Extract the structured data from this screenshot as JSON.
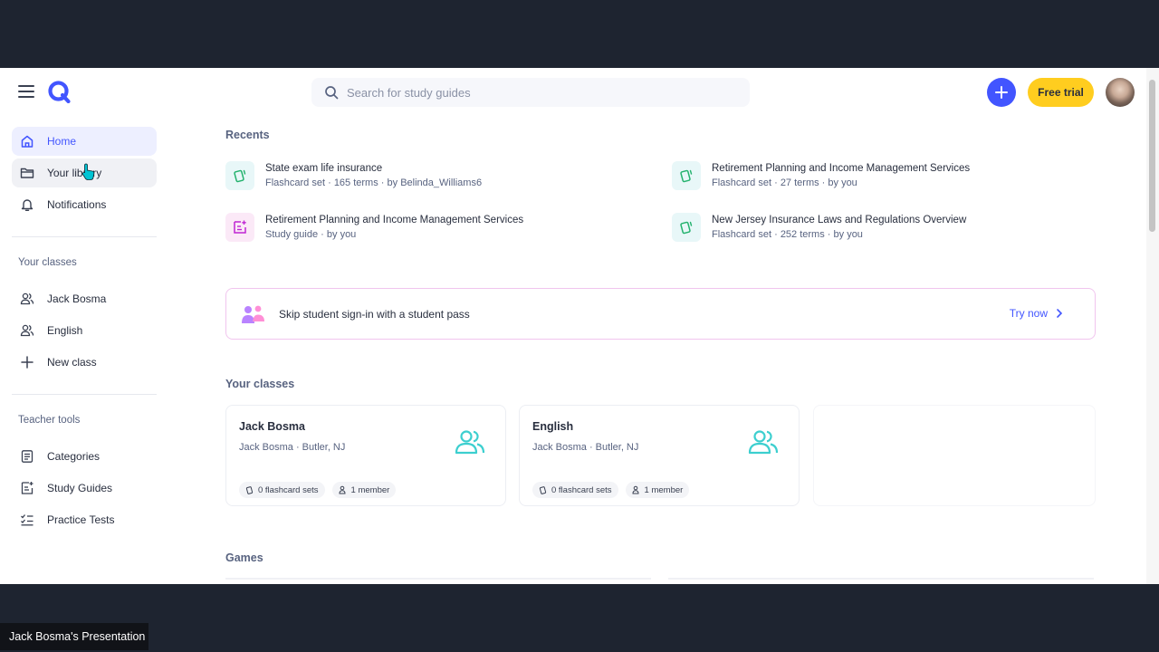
{
  "header": {
    "search_placeholder": "Search for study guides",
    "free_trial_label": "Free trial"
  },
  "sidebar": {
    "nav": [
      {
        "label": "Home",
        "icon": "home-icon"
      },
      {
        "label": "Your library",
        "icon": "folder-icon"
      },
      {
        "label": "Notifications",
        "icon": "bell-icon"
      }
    ],
    "classes_heading": "Your classes",
    "classes": [
      {
        "label": "Jack Bosma",
        "icon": "people-icon"
      },
      {
        "label": "English",
        "icon": "people-icon"
      },
      {
        "label": "New class",
        "icon": "plus-icon"
      }
    ],
    "tools_heading": "Teacher tools",
    "tools": [
      {
        "label": "Categories",
        "icon": "list-icon"
      },
      {
        "label": "Study Guides",
        "icon": "study-guide-icon"
      },
      {
        "label": "Practice Tests",
        "icon": "checklist-icon"
      }
    ]
  },
  "recents": {
    "heading": "Recents",
    "items": [
      {
        "title": "State exam life insurance",
        "type": "Flashcard set",
        "terms": "165 terms",
        "owner": "by Belinda_Williams6"
      },
      {
        "title": "Retirement Planning and Income Management Services",
        "type": "Flashcard set",
        "terms": "27 terms",
        "owner": "by you"
      },
      {
        "title": "Retirement Planning and Income Management Services",
        "type": "Study guide",
        "owner": "by you"
      },
      {
        "title": "New Jersey Insurance Laws and Regulations Overview",
        "type": "Flashcard set",
        "terms": "252 terms",
        "owner": "by you"
      }
    ]
  },
  "student_pass": {
    "text": "Skip student sign-in with a student pass",
    "cta": "Try now"
  },
  "your_classes": {
    "heading": "Your classes",
    "cards": [
      {
        "name": "Jack Bosma",
        "location": "Jack Bosma · Butler, NJ",
        "sets": "0 flashcard sets",
        "members": "1 member"
      },
      {
        "name": "English",
        "location": "Jack Bosma · Butler, NJ",
        "sets": "0 flashcard sets",
        "members": "1 member"
      }
    ]
  },
  "games": {
    "heading": "Games"
  },
  "caption": "Jack Bosma's Presentation",
  "colors": {
    "accent": "#4255ff",
    "trial": "#ffcd1f",
    "page_bg": "#1e2430"
  }
}
